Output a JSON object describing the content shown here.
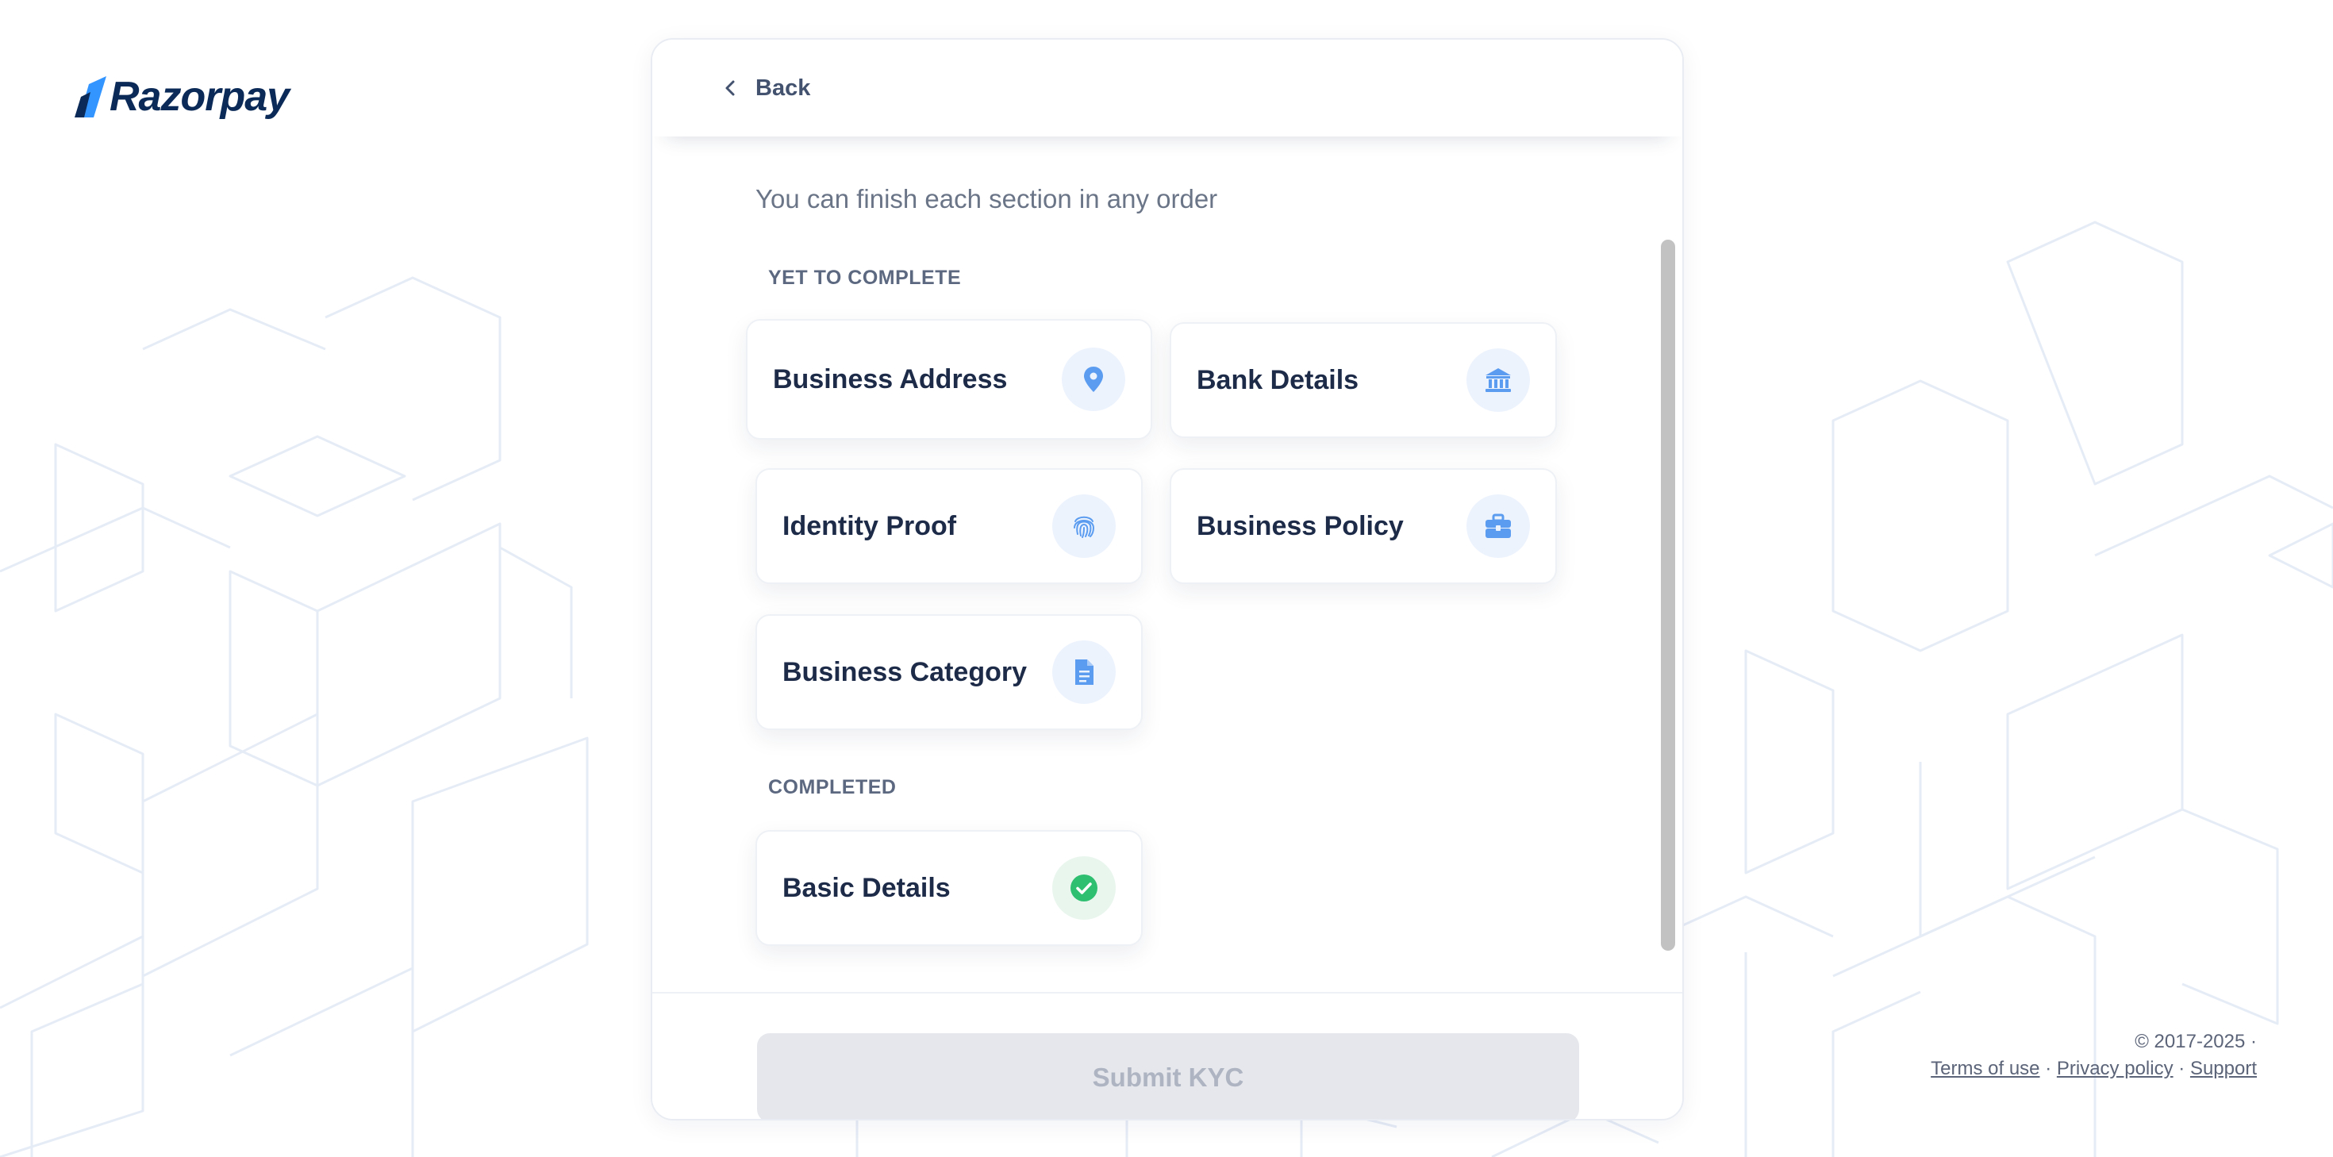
{
  "brand": {
    "name": "Razorpay",
    "logo_color": "#0b2a57",
    "accent": "#3395ff"
  },
  "header": {
    "back_label": "Back"
  },
  "main": {
    "subtitle": "You can finish each section in any order",
    "pending_section": {
      "label": "YET TO COMPLETE",
      "items": [
        {
          "label": "Business Address",
          "icon": "location-pin-icon"
        },
        {
          "label": "Bank Details",
          "icon": "bank-icon"
        },
        {
          "label": "Identity Proof",
          "icon": "fingerprint-icon"
        },
        {
          "label": "Business Policy",
          "icon": "briefcase-icon"
        },
        {
          "label": "Business Category",
          "icon": "document-icon"
        }
      ]
    },
    "completed_section": {
      "label": "COMPLETED",
      "items": [
        {
          "label": "Basic Details",
          "icon": "check-circle-icon",
          "status_color": "#2fbf71"
        }
      ]
    }
  },
  "footer": {
    "submit_label": "Submit KYC",
    "submit_disabled": true,
    "copyright": "© 2017-2025 ·",
    "links": {
      "terms": "Terms of use",
      "privacy": "Privacy policy",
      "support": "Support"
    },
    "separator": "·"
  },
  "colors": {
    "icon_blue": "#5b9cf0",
    "icon_bg": "#edf3fd",
    "success": "#2fbf71"
  }
}
